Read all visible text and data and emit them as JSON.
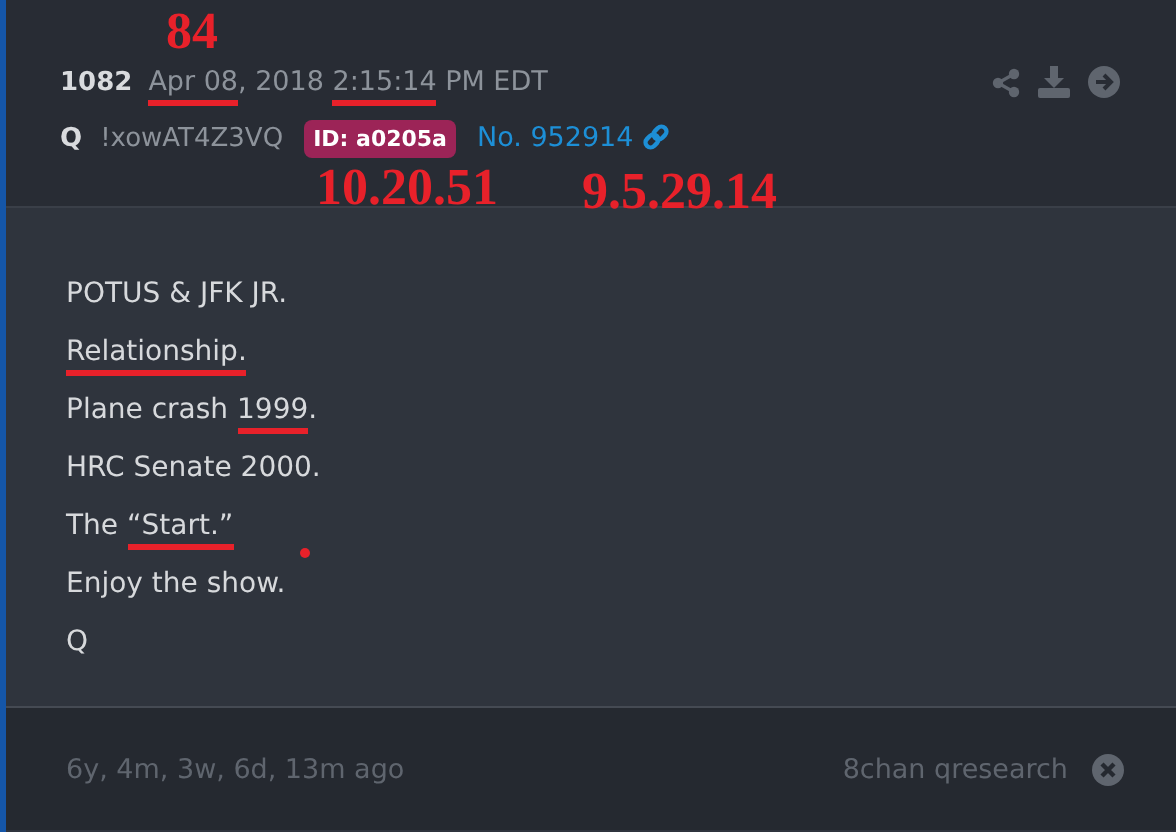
{
  "post": {
    "number": "1082",
    "timestamp": [
      {
        "text": "Apr 08",
        "underlined": true
      },
      {
        "text": ", 2018 ",
        "underlined": false
      },
      {
        "text": "2:15:14",
        "underlined": true
      },
      {
        "text": " PM EDT",
        "underlined": false
      }
    ],
    "author": "Q",
    "tripcode": "!xowAT4Z3VQ",
    "id_badge": "ID: a0205a",
    "post_link": "No. 952914",
    "body": [
      [
        {
          "text": "POTUS & JFK JR.",
          "underlined": false
        }
      ],
      [
        {
          "text": "Relationship.",
          "underlined": true
        }
      ],
      [
        {
          "text": "Plane crash ",
          "underlined": false
        },
        {
          "text": "1999",
          "underlined": true
        },
        {
          "text": ".",
          "underlined": false
        }
      ],
      [
        {
          "text": "HRC Senate 2000.",
          "underlined": false
        }
      ],
      [
        {
          "text": "The ",
          "underlined": false
        },
        {
          "text": "“Start.”",
          "underlined": true
        }
      ],
      [
        {
          "text": "Enjoy the show.",
          "underlined": false
        }
      ],
      [
        {
          "text": "Q",
          "underlined": false
        }
      ]
    ],
    "footer": {
      "age": "6y, 4m, 3w, 6d, 13m ago",
      "source": "8chan qresearch"
    }
  },
  "annotations": [
    {
      "kind": "number",
      "text": "84"
    },
    {
      "kind": "number",
      "text": "10.20.51"
    },
    {
      "kind": "number",
      "text": "9.5.29.14"
    },
    {
      "kind": "dot"
    }
  ]
}
